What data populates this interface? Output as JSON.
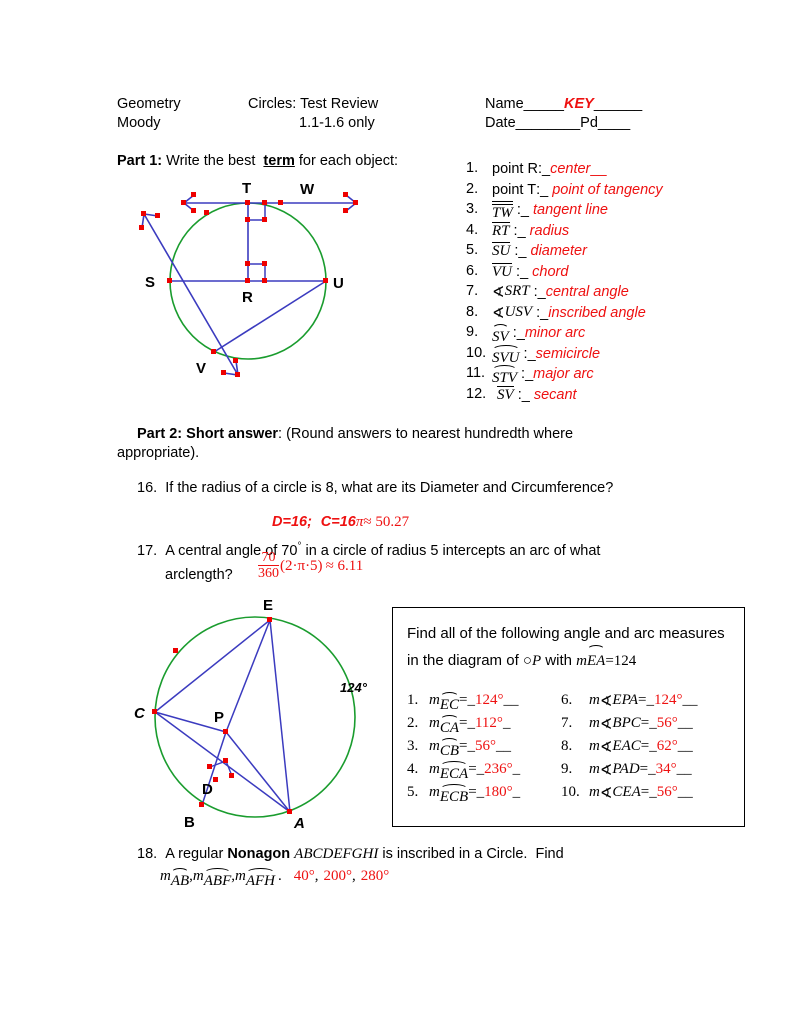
{
  "header": {
    "course": "Geometry",
    "teacher": "Moody",
    "title": "Circles: Test Review",
    "subtitle": "1.1-1.6 only",
    "name_label": "Name_____",
    "name_value": "KEY",
    "name_tail": "______",
    "date_label": "Date________",
    "period_label": "Pd____"
  },
  "part1": {
    "heading_bold": "Part 1:",
    "heading_rest_a": " Write the best  ",
    "heading_term": "term",
    "heading_rest_b": " for each object:",
    "items": [
      {
        "num": "1.",
        "obj": "point R",
        "obj_kind": "plain",
        "sep": ":",
        "blank_pre": "_",
        "answer": "center",
        "blank_post": "__"
      },
      {
        "num": "2.",
        "obj": "point T",
        "obj_kind": "plain",
        "sep": ":",
        "blank_pre": "_ ",
        "answer": "point of tangency",
        "blank_post": ""
      },
      {
        "num": "3.",
        "obj": "TW",
        "obj_kind": "line",
        "sep": " :",
        "blank_pre": "_ ",
        "answer": "tangent line",
        "blank_post": ""
      },
      {
        "num": "4.",
        "obj": "RT",
        "obj_kind": "segment",
        "sep": " :",
        "blank_pre": "_ ",
        "answer": "radius",
        "blank_post": ""
      },
      {
        "num": "5.",
        "obj": "SU",
        "obj_kind": "segment",
        "sep": " :",
        "blank_pre": "_ ",
        "answer": "diameter",
        "blank_post": ""
      },
      {
        "num": "6.",
        "obj": "VU",
        "obj_kind": "segment",
        "sep": " :",
        "blank_pre": "_ ",
        "answer": "chord",
        "blank_post": ""
      },
      {
        "num": "7.",
        "obj": "SRT",
        "obj_kind": "angle",
        "sep": " :",
        "blank_pre": "_",
        "answer": "central angle",
        "blank_post": ""
      },
      {
        "num": "8.",
        "obj": "USV",
        "obj_kind": "angle",
        "sep": " :",
        "blank_pre": "_",
        "answer": "inscribed angle",
        "blank_post": ""
      },
      {
        "num": "9.",
        "obj": "SV",
        "obj_kind": "arc",
        "sep": " :",
        "blank_pre": "_",
        "answer": "minor arc",
        "blank_post": ""
      },
      {
        "num": "10.",
        "obj": "SVU",
        "obj_kind": "arc",
        "sep": " :",
        "blank_pre": "_",
        "answer": "semicircle",
        "blank_post": ""
      },
      {
        "num": "11.",
        "obj": "STV",
        "obj_kind": "arc",
        "sep": " :",
        "blank_pre": "_",
        "answer": "major arc",
        "blank_post": ""
      },
      {
        "num": "12.",
        "obj": "SV",
        "obj_kind": "segment",
        "sep": " :",
        "blank_pre": "_ ",
        "answer": "secant",
        "blank_post": ""
      }
    ]
  },
  "diagram1": {
    "labels": {
      "T": "T",
      "W": "W",
      "S": "S",
      "R": "R",
      "U": "U",
      "V": "V"
    },
    "circle_color": "#1a9c2e",
    "line_color": "#3b3bbf",
    "point_color": "#ee0000"
  },
  "part2": {
    "heading_bold_a": "Part 2:",
    "heading_bold_b": "  Short answer",
    "heading_rest": ": (Round answers  to nearest hundredth where",
    "heading_line2": "appropriate).",
    "q16": {
      "num": "16.",
      "text": "If the radius of a circle is 8, what are its Diameter and Circumference?",
      "answer_a": "D=16;",
      "answer_b": "C=16",
      "answer_pi": "π",
      "answer_c": "≈ 50.27"
    },
    "q17": {
      "num": "17.",
      "text_a": "A central angle of 70",
      "deg": "°",
      "text_b": " in a circle of radius 5 intercepts an arc of what",
      "text_c": "arclength?",
      "frac_num": "70",
      "frac_den": "360",
      "expr": "(2·π·5)",
      "approx": "≈ 6.11"
    },
    "q18": {
      "num": "18.",
      "text_a": "A regular ",
      "bold": "Nonagon",
      "name": "ABCDEFGHI",
      "text_b": " is inscribed in a Circle.  Find",
      "m1": "AB",
      "m2": "ABF",
      "m3": "AFH",
      "period": ".",
      "ans1": "40°",
      "ans2": "200°",
      "ans3": "280°",
      "comma": ","
    }
  },
  "diagram2": {
    "labels": {
      "E": "E",
      "P": "P",
      "C": "C",
      "D": "D",
      "B": "B",
      "A": "A",
      "arc_measure": "124°"
    },
    "circle_color": "#1a9c2e",
    "line_color": "#3b3bbf",
    "point_color": "#ee0000"
  },
  "measures_box": {
    "head_line1": "Find all of the following angle and arc measures",
    "head_line2_a": "in the diagram of ",
    "head_circle_sym": "○",
    "head_P": "P",
    "head_line2_b": " with ",
    "head_m": "m",
    "head_arc": "EA",
    "head_eq": "=124",
    "left": [
      {
        "num": "1.",
        "m": "m",
        "obj": "EC",
        "obj_kind": "arc",
        "eq": "=",
        "pre": "_",
        "ans": "124°",
        "post": "__"
      },
      {
        "num": "2.",
        "m": "m",
        "obj": "CA",
        "obj_kind": "arc",
        "eq": "=",
        "pre": "_",
        "ans": "112°",
        "post": "_"
      },
      {
        "num": "3.",
        "m": "m",
        "obj": "CB",
        "obj_kind": "arc",
        "eq": "=",
        "pre": "_",
        "ans": "56°",
        "post": "__"
      },
      {
        "num": "4.",
        "m": "m",
        "obj": "ECA",
        "obj_kind": "arc",
        "eq": "=",
        "pre": "_",
        "ans": "236°",
        "post": "_"
      },
      {
        "num": "5.",
        "m": "m",
        "obj": "ECB",
        "obj_kind": "arc",
        "eq": "=",
        "pre": "_",
        "ans": "180°",
        "post": "_"
      }
    ],
    "right": [
      {
        "num": "6.",
        "m": "m",
        "obj": "EPA",
        "obj_kind": "angle",
        "eq": "=",
        "pre": "_",
        "ans": "124°",
        "post": "__"
      },
      {
        "num": "7.",
        "m": "m",
        "obj": "BPC",
        "obj_kind": "angle",
        "eq": "=",
        "pre": "_",
        "ans": "56°",
        "post": "__"
      },
      {
        "num": "8.",
        "m": "m",
        "obj": "EAC",
        "obj_kind": "angle",
        "eq": "=",
        "pre": "_",
        "ans": "62°",
        "post": "__"
      },
      {
        "num": "9.",
        "m": "m",
        "obj": "PAD",
        "obj_kind": "angle",
        "eq": "=",
        "pre": "_",
        "ans": "34°",
        "post": "__"
      },
      {
        "num": "10.",
        "m": "m",
        "obj": "CEA",
        "obj_kind": "angle",
        "eq": "=",
        "pre": "_",
        "ans": "56°",
        "post": "__"
      }
    ]
  }
}
